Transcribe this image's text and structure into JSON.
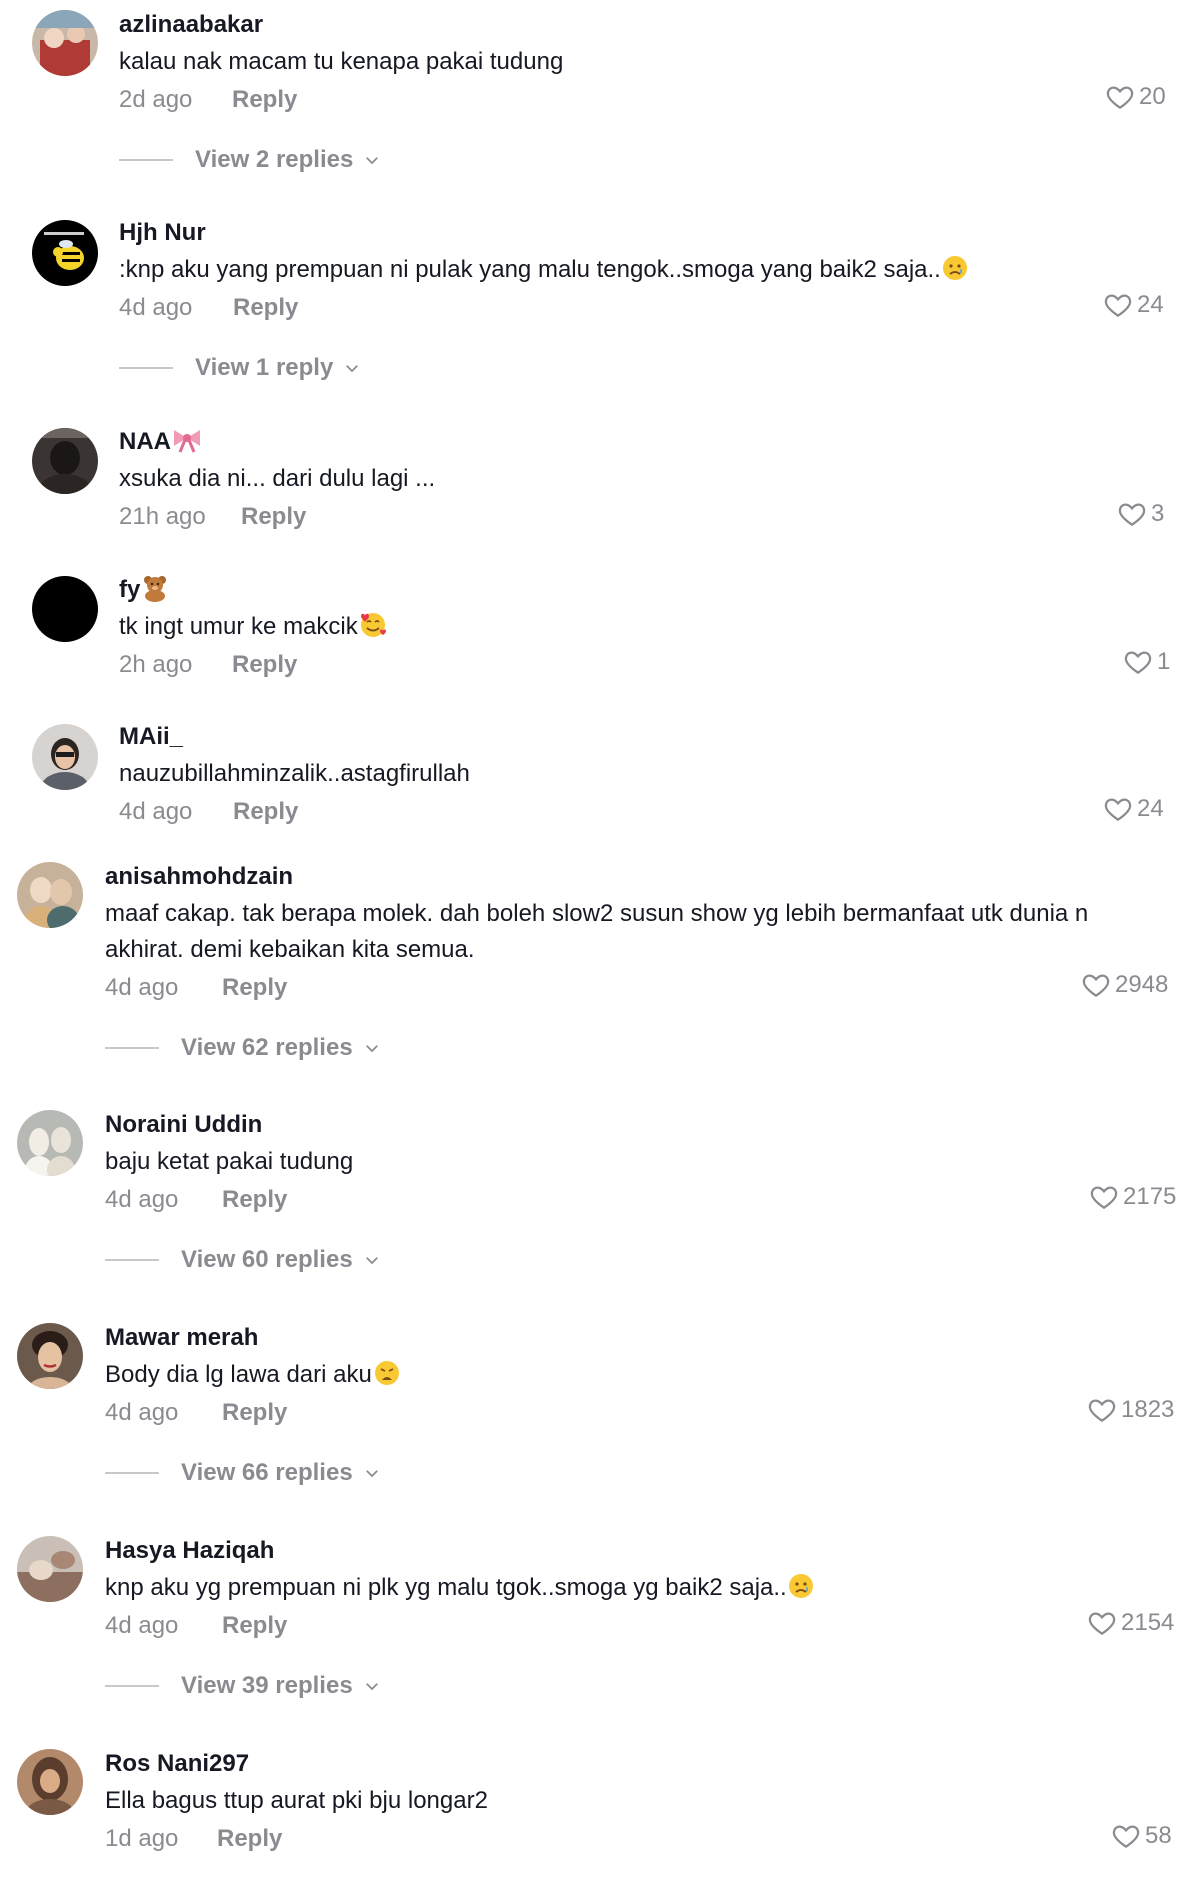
{
  "comments": [
    {
      "username": "azlinaabakar",
      "text": "kalau nak macam tu kenapa pakai tudung",
      "time": "2d ago",
      "reply": "Reply",
      "likes": "20",
      "view_replies": "View 2 replies"
    },
    {
      "username": "Hjh Nur",
      "text": ":knp aku yang prempuan ni pulak yang malu tengok..smoga yang baik2 saja..",
      "time": "4d ago",
      "reply": "Reply",
      "likes": "24",
      "view_replies": "View 1 reply"
    },
    {
      "username": "NAA",
      "text": "xsuka dia ni... dari dulu lagi ...",
      "time": "21h ago",
      "reply": "Reply",
      "likes": "3"
    },
    {
      "username": "fy",
      "text": "tk ingt umur ke makcik",
      "time": "2h ago",
      "reply": "Reply",
      "likes": "1"
    },
    {
      "username": "MAii_",
      "text": "nauzubillahminzalik..astagfirullah",
      "time": "4d ago",
      "reply": "Reply",
      "likes": "24"
    },
    {
      "username": "anisahmohdzain",
      "text": "maaf cakap. tak berapa molek. dah boleh slow2 susun show yg lebih bermanfaat utk dunia n akhirat. demi kebaikan kita semua.",
      "time": "4d ago",
      "reply": "Reply",
      "likes": "2948",
      "view_replies": "View 62 replies"
    },
    {
      "username": "Noraini Uddin",
      "text": "baju ketat pakai tudung",
      "time": "4d ago",
      "reply": "Reply",
      "likes": "2175",
      "view_replies": "View 60 replies"
    },
    {
      "username": "Mawar merah",
      "text": "Body dia lg lawa dari aku",
      "time": "4d ago",
      "reply": "Reply",
      "likes": "1823",
      "view_replies": "View 66 replies"
    },
    {
      "username": "Hasya Haziqah",
      "text": "knp aku yg prempuan ni plk yg malu tgok..smoga yg baik2 saja..",
      "time": "4d ago",
      "reply": "Reply",
      "likes": "2154",
      "view_replies": "View 39 replies"
    },
    {
      "username": "Ros Nani297",
      "text": "Ella bagus ttup aurat pki bju longar2",
      "time": "1d ago",
      "reply": "Reply",
      "likes": "58"
    }
  ],
  "icons": {
    "like": "heart-outline-icon",
    "expand": "chevron-down-icon"
  },
  "colors": {
    "text": "#161823",
    "muted": "#8a8b91",
    "divider": "#c8c8cc"
  }
}
